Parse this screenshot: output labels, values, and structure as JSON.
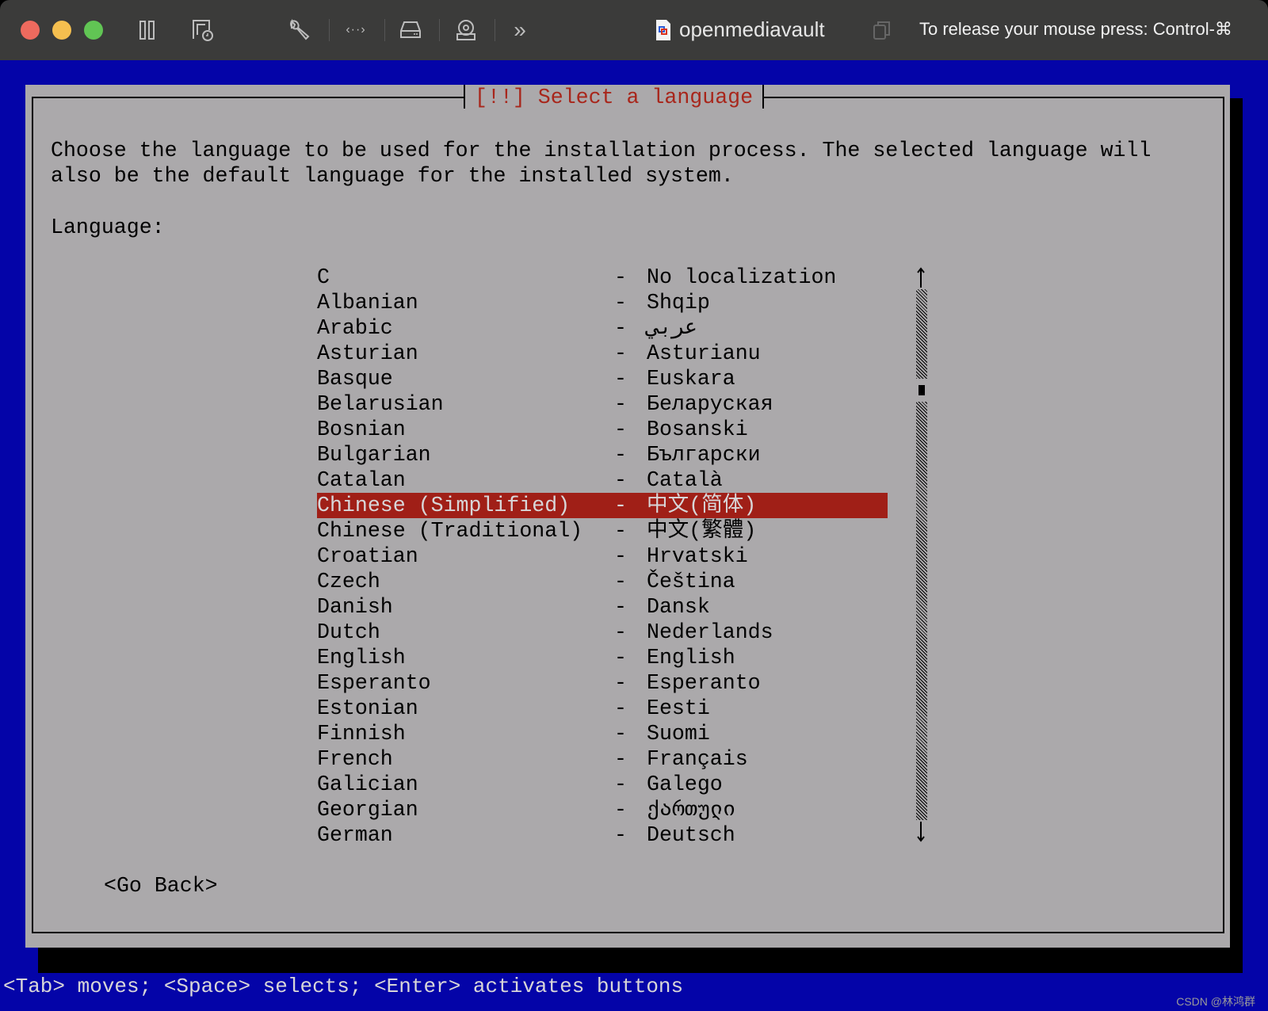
{
  "window": {
    "title": "openmediavault",
    "release_hint": "To release your mouse press: Control-⌘",
    "toolbar_icons": [
      "pause-icon",
      "snapshot-icon",
      "wrench-icon",
      "code-icon",
      "disk-icon",
      "camera-icon",
      "more-icon"
    ]
  },
  "dialog": {
    "title": "[!!] Select a language",
    "description_line1": "Choose the language to be used for the installation process. The selected language will",
    "description_line2": "also be the default language for the installed system.",
    "field_label": "Language:",
    "selected_index": 9,
    "languages": [
      {
        "name": "C",
        "native": "No localization"
      },
      {
        "name": "Albanian",
        "native": "Shqip"
      },
      {
        "name": "Arabic",
        "native": "عربي"
      },
      {
        "name": "Asturian",
        "native": "Asturianu"
      },
      {
        "name": "Basque",
        "native": "Euskara"
      },
      {
        "name": "Belarusian",
        "native": "Беларуская"
      },
      {
        "name": "Bosnian",
        "native": "Bosanski"
      },
      {
        "name": "Bulgarian",
        "native": "Български"
      },
      {
        "name": "Catalan",
        "native": "Català"
      },
      {
        "name": "Chinese (Simplified)",
        "native": "中文(简体)"
      },
      {
        "name": "Chinese (Traditional)",
        "native": "中文(繁體)"
      },
      {
        "name": "Croatian",
        "native": "Hrvatski"
      },
      {
        "name": "Czech",
        "native": "Čeština"
      },
      {
        "name": "Danish",
        "native": "Dansk"
      },
      {
        "name": "Dutch",
        "native": "Nederlands"
      },
      {
        "name": "English",
        "native": "English"
      },
      {
        "name": "Esperanto",
        "native": "Esperanto"
      },
      {
        "name": "Estonian",
        "native": "Eesti"
      },
      {
        "name": "Finnish",
        "native": "Suomi"
      },
      {
        "name": "French",
        "native": "Français"
      },
      {
        "name": "Galician",
        "native": "Galego"
      },
      {
        "name": "Georgian",
        "native": "ქართული"
      },
      {
        "name": "German",
        "native": "Deutsch"
      }
    ],
    "separator": "-",
    "scroll_position": 0.18,
    "go_back_label": "<Go Back>"
  },
  "status_bar": "<Tab> moves; <Space> selects; <Enter> activates buttons",
  "watermark": "CSDN @林鸿群"
}
